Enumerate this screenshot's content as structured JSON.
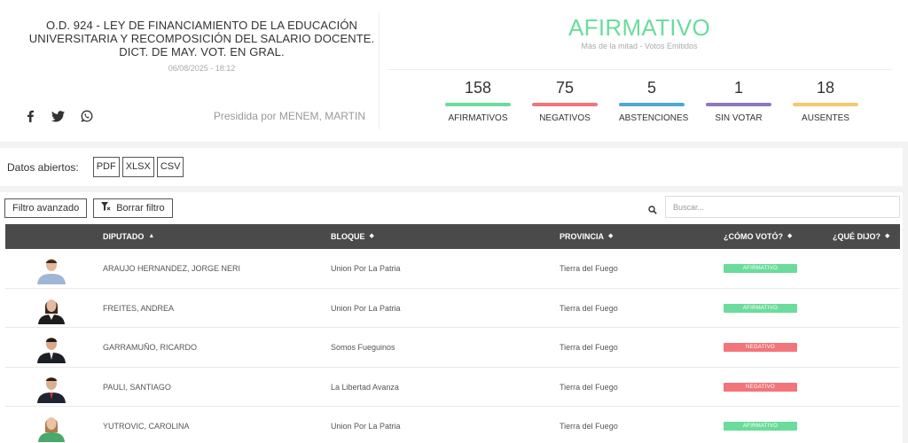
{
  "vote": {
    "title": "O.D. 924 - LEY DE FINANCIAMIENTO DE LA EDUCACIÓN UNIVERSITARIA Y RECOMPOSICIÓN DEL SALARIO DOCENTE. DICT. DE MAY. VOT. EN GRAL.",
    "date": "06/08/2025 - 18:12",
    "presided_by": "Presidida por MENEM, MARTIN",
    "result": "AFIRMATIVO",
    "result_color": "#6bdc9c",
    "result_subtitle": "Más de la mitad - Votos Emitidos"
  },
  "social": [
    {
      "icon": "facebook-icon"
    },
    {
      "icon": "twitter-icon"
    },
    {
      "icon": "whatsapp-icon"
    }
  ],
  "counts": [
    {
      "value": "158",
      "label": "AFIRMATIVOS",
      "color": "#6bdc9c"
    },
    {
      "value": "75",
      "label": "NEGATIVOS",
      "color": "#f2757a"
    },
    {
      "value": "5",
      "label": "ABSTENCIONES",
      "color": "#4ba9d6"
    },
    {
      "value": "1",
      "label": "SIN VOTAR",
      "color": "#8c77c6"
    },
    {
      "value": "18",
      "label": "AUSENTES",
      "color": "#f7c86c"
    }
  ],
  "open_data": {
    "label": "Datos abiertos:",
    "formats": [
      "PDF",
      "XLSX",
      "CSV"
    ]
  },
  "filters": {
    "advanced": "Filtro avanzado",
    "clear": "Borrar filtro",
    "search_placeholder": "Buscar..."
  },
  "table": {
    "columns": {
      "diputado": "DIPUTADO",
      "bloque": "BLOQUE",
      "provincia": "PROVINCIA",
      "como_voto": "¿CÓMO VOTÓ?",
      "que_dijo": "¿QUÉ DIJO?"
    },
    "rows": [
      {
        "name": "ARAUJO HERNANDEZ, JORGE NERI",
        "bloque": "Union Por La Patria",
        "provincia": "Tierra del Fuego",
        "voto": "AFIRMATIVO",
        "voto_color": "#6bdc9c"
      },
      {
        "name": "FREITES, ANDREA",
        "bloque": "Union Por La Patria",
        "provincia": "Tierra del Fuego",
        "voto": "AFIRMATIVO",
        "voto_color": "#6bdc9c"
      },
      {
        "name": "GARRAMUÑO, RICARDO",
        "bloque": "Somos Fueguinos",
        "provincia": "Tierra del Fuego",
        "voto": "NEGATIVO",
        "voto_color": "#f2757a"
      },
      {
        "name": "PAULI, SANTIAGO",
        "bloque": "La Libertad Avanza",
        "provincia": "Tierra del Fuego",
        "voto": "NEGATIVO",
        "voto_color": "#f2757a"
      },
      {
        "name": "YUTROVIC, CAROLINA",
        "bloque": "Union Por La Patria",
        "provincia": "Tierra del Fuego",
        "voto": "AFIRMATIVO",
        "voto_color": "#6bdc9c"
      }
    ]
  }
}
